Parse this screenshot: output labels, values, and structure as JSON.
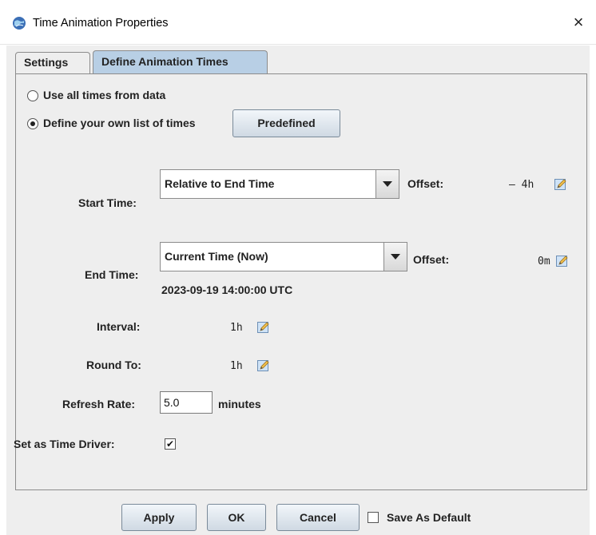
{
  "window": {
    "title": "Time Animation Properties",
    "close_glyph": "×",
    "icon": "app-globe-icon"
  },
  "tabs": [
    {
      "label": "Settings",
      "active": false
    },
    {
      "label": "Define Animation Times",
      "active": true
    }
  ],
  "mode": {
    "use_all_label": "Use all times from data",
    "use_all_selected": false,
    "define_own_label": "Define your own list of times",
    "define_own_selected": true,
    "predefined_label": "Predefined"
  },
  "start_time": {
    "label": "Start Time:",
    "selected": "Relative to End Time",
    "offset_label": "Offset:",
    "offset_value": "– 4h"
  },
  "end_time": {
    "label": "End Time:",
    "selected": "Current Time (Now)",
    "offset_label": "Offset:",
    "offset_value": "0m",
    "resolved": "2023-09-19 14:00:00 UTC"
  },
  "interval": {
    "label": "Interval:",
    "value": "1h"
  },
  "round_to": {
    "label": "Round To:",
    "value": "1h"
  },
  "refresh": {
    "label": "Refresh Rate:",
    "value": "5.0",
    "unit": "minutes"
  },
  "time_driver": {
    "label": "Set as Time Driver:",
    "checked": true,
    "check_glyph": "✔"
  },
  "footer": {
    "apply_label": "Apply",
    "ok_label": "OK",
    "cancel_label": "Cancel",
    "save_default_label": "Save As Default",
    "save_default_checked": false
  },
  "colors": {
    "active_tab": "#b8cfe5",
    "background": "#eeeeee",
    "button_gradient_top": "#f2f6fa",
    "button_gradient_bottom": "#cfd9e3"
  }
}
